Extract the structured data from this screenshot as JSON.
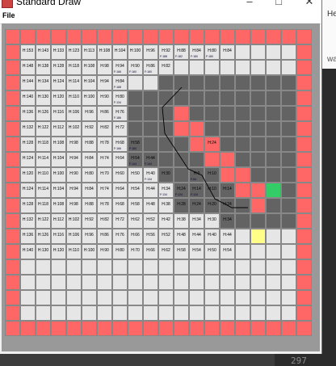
{
  "window": {
    "title": "Standard Draw",
    "min_glyph": "–",
    "max_glyph": "□",
    "close_glyph": "✕"
  },
  "menu": {
    "file_label": "File"
  },
  "background": {
    "frag_top": "He",
    "frag_mid": "wa",
    "line_number": "297"
  },
  "colors": {
    "wall": "#ff6666",
    "floor": "#e6e6e6",
    "obstacle": "#636363",
    "path": "#ff6666",
    "goal": "#33cc66",
    "start": "#ffff88",
    "route_line": "#000000"
  },
  "grid": {
    "size": 20,
    "heuristics": [
      [
        "",
        "",
        "",
        "",
        "",
        "",
        "",
        "",
        "",
        "",
        "",
        "",
        "",
        "",
        "",
        "",
        "",
        "",
        "",
        ""
      ],
      [
        "",
        "H:153",
        "H:143",
        "H:133",
        "H:123",
        "H:113",
        "H:108",
        "H:104",
        "H:100",
        "H:96",
        "H:92",
        "H:88",
        "H:84",
        "H:80",
        "H:84",
        "",
        "",
        "",
        "",
        ""
      ],
      [
        "",
        "H:148",
        "H:138",
        "H:128",
        "H:118",
        "H:108",
        "H:98",
        "H:94",
        "H:90",
        "H:86",
        "H:82",
        "",
        "",
        "",
        "",
        "",
        "",
        "",
        "",
        ""
      ],
      [
        "",
        "H:144",
        "H:134",
        "H:124",
        "H:114",
        "H:104",
        "H:94",
        "H:84",
        "",
        "",
        "",
        "",
        "",
        "",
        "",
        "",
        "",
        "",
        "",
        ""
      ],
      [
        "",
        "H:140",
        "H:130",
        "H:120",
        "H:110",
        "H:100",
        "H:90",
        "H:80",
        "",
        "",
        "",
        "",
        "",
        "",
        "",
        "",
        "",
        "",
        "",
        ""
      ],
      [
        "",
        "H:136",
        "H:126",
        "H:116",
        "H:106",
        "H:96",
        "H:86",
        "H:76",
        "",
        "",
        "",
        "",
        "",
        "",
        "",
        "",
        "",
        "",
        "",
        ""
      ],
      [
        "",
        "H:132",
        "H:122",
        "H:112",
        "H:102",
        "H:92",
        "H:82",
        "H:72",
        "",
        "",
        "",
        "",
        "",
        "",
        "",
        "",
        "",
        "",
        "",
        ""
      ],
      [
        "",
        "H:128",
        "H:118",
        "H:108",
        "H:98",
        "H:88",
        "H:78",
        "H:68",
        "H:58",
        "",
        "",
        "",
        "",
        "H:24",
        "",
        "",
        "",
        "",
        "",
        ""
      ],
      [
        "",
        "H:124",
        "H:114",
        "H:104",
        "H:94",
        "H:84",
        "H:74",
        "H:64",
        "H:54",
        "H:44",
        "",
        "",
        "",
        "",
        "",
        "",
        "",
        "",
        "",
        ""
      ],
      [
        "",
        "H:120",
        "H:110",
        "H:100",
        "H:90",
        "H:80",
        "H:70",
        "H:60",
        "H:50",
        "H:40",
        "H:30",
        "",
        "H:0",
        "H:10",
        "",
        "",
        "",
        "",
        "",
        ""
      ],
      [
        "",
        "H:124",
        "H:114",
        "H:104",
        "H:94",
        "H:84",
        "H:74",
        "H:64",
        "H:54",
        "H:44",
        "H:34",
        "H:24",
        "H:14",
        "H:10",
        "H:14",
        "",
        "",
        "",
        "",
        ""
      ],
      [
        "",
        "H:128",
        "H:118",
        "H:108",
        "H:98",
        "H:88",
        "H:78",
        "H:68",
        "H:58",
        "H:48",
        "H:38",
        "H:28",
        "H:24",
        "H:20",
        "H:24",
        "",
        "",
        "",
        "",
        ""
      ],
      [
        "",
        "H:132",
        "H:122",
        "H:112",
        "H:102",
        "H:92",
        "H:82",
        "H:72",
        "H:62",
        "H:52",
        "H:42",
        "H:38",
        "H:34",
        "H:30",
        "H:34",
        "",
        "",
        "",
        "",
        ""
      ],
      [
        "",
        "H:136",
        "H:126",
        "H:116",
        "H:106",
        "H:96",
        "H:86",
        "H:76",
        "H:66",
        "H:56",
        "H:52",
        "H:48",
        "H:44",
        "H:40",
        "H:44",
        "",
        "",
        "",
        "",
        ""
      ],
      [
        "",
        "H:140",
        "H:130",
        "H:120",
        "H:110",
        "H:100",
        "H:90",
        "H:80",
        "H:70",
        "H:66",
        "H:62",
        "H:58",
        "H:54",
        "H:50",
        "H:54",
        "",
        "",
        "",
        "",
        ""
      ],
      [
        "",
        "",
        "",
        "",
        "",
        "",
        "",
        "",
        "",
        "",
        "",
        "",
        "",
        "",
        "",
        "",
        "",
        "",
        "",
        ""
      ],
      [
        "",
        "",
        "",
        "",
        "",
        "",
        "",
        "",
        "",
        "",
        "",
        "",
        "",
        "",
        "",
        "",
        "",
        "",
        "",
        ""
      ],
      [
        "",
        "",
        "",
        "",
        "",
        "",
        "",
        "",
        "",
        "",
        "",
        "",
        "",
        "",
        "",
        "",
        "",
        "",
        "",
        ""
      ],
      [
        "",
        "",
        "",
        "",
        "",
        "",
        "",
        "",
        "",
        "",
        "",
        "",
        "",
        "",
        "",
        "",
        "",
        "",
        "",
        ""
      ],
      [
        "",
        "",
        "",
        "",
        "",
        "",
        "",
        "",
        "",
        "",
        "",
        "",
        "",
        "",
        "",
        "",
        "",
        "",
        "",
        ""
      ]
    ],
    "f_scores": [
      {
        "row": 1,
        "col": 10,
        "text": "F:188"
      },
      {
        "row": 1,
        "col": 11,
        "text": "F:182"
      },
      {
        "row": 1,
        "col": 12,
        "text": "F:180"
      },
      {
        "row": 1,
        "col": 13,
        "text": "F:180"
      },
      {
        "row": 2,
        "col": 7,
        "text": "F:166"
      },
      {
        "row": 2,
        "col": 8,
        "text": "F:160"
      },
      {
        "row": 2,
        "col": 9,
        "text": "F:160"
      },
      {
        "row": 3,
        "col": 7,
        "text": "F:168"
      },
      {
        "row": 4,
        "col": 7,
        "text": "F:134"
      },
      {
        "row": 5,
        "col": 7,
        "text": "F:186"
      },
      {
        "row": 7,
        "col": 7,
        "text": "F:166"
      },
      {
        "row": 7,
        "col": 8,
        "text": "F:160"
      },
      {
        "row": 8,
        "col": 8,
        "text": "F:144"
      },
      {
        "row": 8,
        "col": 9,
        "text": "F:144"
      },
      {
        "row": 9,
        "col": 9,
        "text": "F:134"
      },
      {
        "row": 9,
        "col": 12,
        "text": "F:64"
      },
      {
        "row": 10,
        "col": 10,
        "text": "F:134"
      },
      {
        "row": 10,
        "col": 11,
        "text": "F:124"
      },
      {
        "row": 10,
        "col": 12,
        "text": "F:124"
      }
    ]
  }
}
